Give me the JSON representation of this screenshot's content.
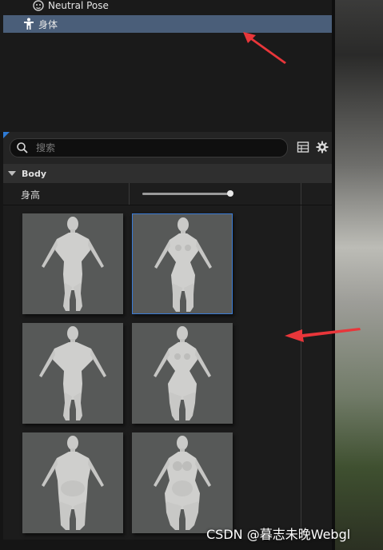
{
  "outliner": {
    "items": [
      {
        "label": "Neutral Pose",
        "icon": "face-icon"
      },
      {
        "label": "身体",
        "icon": "body-icon",
        "selected": true
      }
    ]
  },
  "details": {
    "search": {
      "placeholder": "搜索",
      "value": ""
    },
    "toolbar": {
      "icons": [
        "grid-view-icon",
        "gear-icon"
      ]
    },
    "category": {
      "label": "Body",
      "expanded": true
    },
    "properties": [
      {
        "name": "身高",
        "slider_value": 1.0
      }
    ],
    "body_presets": [
      {
        "build": "male-average",
        "selected": false
      },
      {
        "build": "female-average",
        "selected": true
      },
      {
        "build": "male-muscular",
        "selected": false
      },
      {
        "build": "female-curvy",
        "selected": false
      },
      {
        "build": "male-heavy",
        "selected": false
      },
      {
        "build": "female-heavy",
        "selected": false
      }
    ]
  },
  "colors": {
    "selection_bg": "#4a5e79",
    "selection_border": "#3a7bd5",
    "annotation_arrow": "#e8363a"
  },
  "watermark": "CSDN @暮志未晚Webgl"
}
